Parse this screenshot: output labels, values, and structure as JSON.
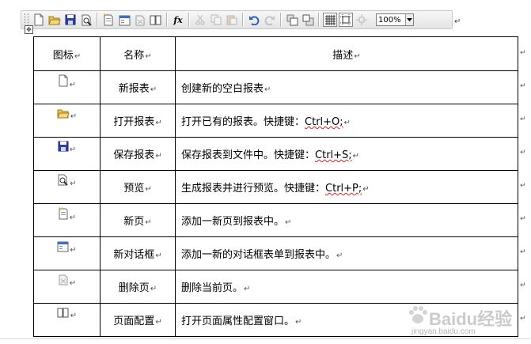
{
  "toolbar": {
    "buttons": [
      {
        "icon": "new-file-icon",
        "state": "normal"
      },
      {
        "icon": "open-folder-icon",
        "state": "normal"
      },
      {
        "icon": "save-icon",
        "state": "normal"
      },
      {
        "icon": "preview-icon",
        "state": "normal"
      },
      {
        "icon": "new-page-icon",
        "state": "normal"
      },
      {
        "icon": "new-dialog-icon",
        "state": "normal"
      },
      {
        "icon": "delete-page-icon",
        "state": "normal"
      },
      {
        "icon": "page-setup-icon",
        "state": "normal"
      },
      {
        "icon": "function-icon",
        "state": "normal"
      },
      {
        "icon": "cut-icon",
        "state": "disabled"
      },
      {
        "icon": "copy-icon",
        "state": "disabled"
      },
      {
        "icon": "paste-icon",
        "state": "disabled"
      },
      {
        "icon": "undo-icon",
        "state": "normal"
      },
      {
        "icon": "redo-icon",
        "state": "disabled"
      },
      {
        "icon": "bring-front-icon",
        "state": "normal"
      },
      {
        "icon": "send-back-icon",
        "state": "normal"
      },
      {
        "icon": "grid-icon",
        "state": "active"
      },
      {
        "icon": "snap-icon",
        "state": "active"
      },
      {
        "icon": "align-icon",
        "state": "disabled"
      }
    ],
    "function_glyph": "fx",
    "zoom": "100%"
  },
  "table": {
    "headers": {
      "icon": "图标",
      "name": "名称",
      "desc": "描述"
    },
    "rows": [
      {
        "icon": "new-report-icon",
        "name": "新报表",
        "desc_prefix": "创建新的空白报表",
        "shortcut": ""
      },
      {
        "icon": "open-report-icon",
        "name": "打开报表",
        "desc_prefix": "打开已有的报表。快捷键：",
        "shortcut": "Ctrl+O;"
      },
      {
        "icon": "save-report-icon",
        "name": "保存报表",
        "desc_prefix": "保存报表到文件中。快捷键：",
        "shortcut": "Ctrl+S;"
      },
      {
        "icon": "preview-report-icon",
        "name": "预览",
        "desc_prefix": "生成报表并进行预览。快捷键：",
        "shortcut": "Ctrl+P;"
      },
      {
        "icon": "new-page-icon",
        "name": "新页",
        "desc_prefix": "添加一新页到报表中。",
        "shortcut": ""
      },
      {
        "icon": "new-dialog-icon",
        "name": "新对话框",
        "desc_prefix": "添加一新的对话框表单到报表中。",
        "shortcut": ""
      },
      {
        "icon": "delete-page-icon",
        "name": "删除页",
        "desc_prefix": "删除当前页。",
        "shortcut": ""
      },
      {
        "icon": "page-setup-icon",
        "name": "页面配置",
        "desc_prefix": "打开页面属性配置窗口。",
        "shortcut": ""
      }
    ]
  },
  "marks": {
    "paragraph": "↵"
  },
  "watermark": {
    "brand": "Baidu经验",
    "url": "jingyan.baidu.com"
  },
  "colors": {
    "toolbar_bg": "#e9e9e9",
    "save_blue": "#2b3fa8",
    "folder_yellow": "#f0c24a",
    "undo_blue": "#2a5fc7",
    "spell_red": "#e02020"
  }
}
